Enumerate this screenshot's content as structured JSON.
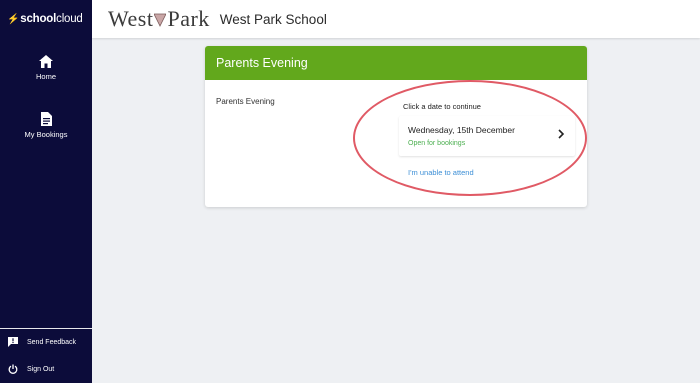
{
  "sidebar": {
    "brand_bolt": "⚡",
    "brand_school": "school",
    "brand_cloud": "cloud",
    "nav": [
      {
        "label": "Home",
        "icon": "home-icon"
      },
      {
        "label": "My Bookings",
        "icon": "document-icon"
      }
    ],
    "bottom": [
      {
        "label": "Send Feedback",
        "icon": "feedback-icon"
      },
      {
        "label": "Sign Out",
        "icon": "power-icon"
      }
    ]
  },
  "header": {
    "logo_west": "West",
    "logo_park": "Park",
    "school_name": "West Park School"
  },
  "card": {
    "title": "Parents Evening",
    "event_label": "Parents Evening",
    "prompt": "Click a date to continue",
    "date": {
      "title": "Wednesday, 15th December",
      "status": "Open for bookings"
    },
    "unable_link": "I'm unable to attend"
  },
  "colors": {
    "sidebar": "#0c0c3a",
    "card_header": "#62a81c",
    "status_green": "#4caf50",
    "link_blue": "#3d8fd6",
    "highlight": "#e05a65"
  }
}
